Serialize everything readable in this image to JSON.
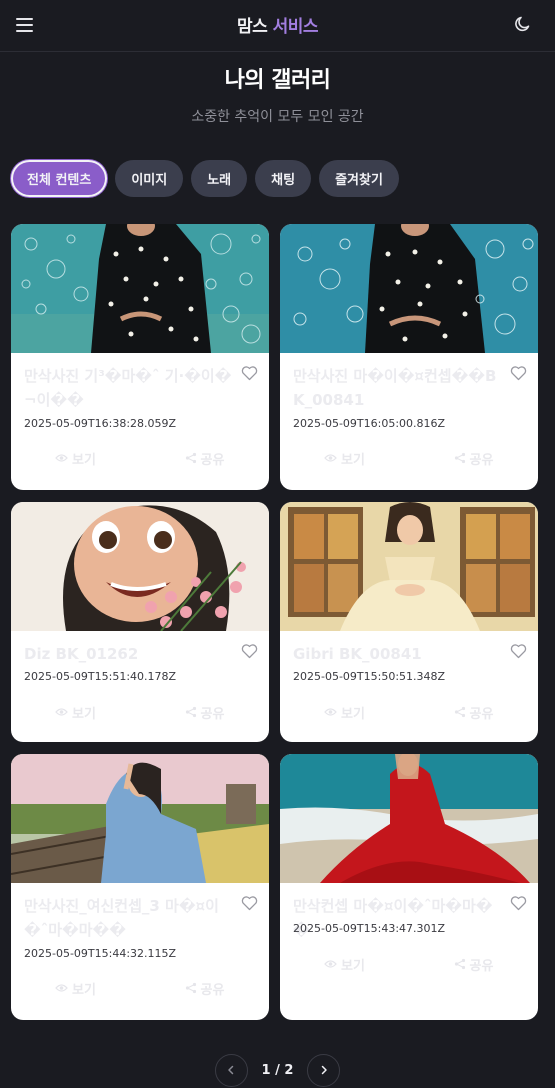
{
  "header": {
    "brand_part1": "맘스",
    "brand_part2": "서비스",
    "menu_icon": "hamburger-menu-icon",
    "theme_icon": "moon-icon"
  },
  "page": {
    "title": "나의 갤러리",
    "subtitle": "소중한 추억이 모두 모인 공간"
  },
  "tabs": [
    {
      "label": "전체 컨텐츠",
      "active": true
    },
    {
      "label": "이미지",
      "active": false
    },
    {
      "label": "노래",
      "active": false
    },
    {
      "label": "채팅",
      "active": false
    },
    {
      "label": "즐겨찾기",
      "active": false
    }
  ],
  "cards": [
    {
      "title": "만삭사진 기³�마�ˆ 기·�이�¬이��",
      "date": "2025-05-09T16:38:28.059Z",
      "view_label": "보기",
      "share_label": "공유"
    },
    {
      "title": "만삭사진 마�이�¤컨셉��BK_00841",
      "date": "2025-05-09T16:05:00.816Z",
      "view_label": "보기",
      "share_label": "공유"
    },
    {
      "title": "Diz BK_01262",
      "date": "2025-05-09T15:51:40.178Z",
      "view_label": "보기",
      "share_label": "공유"
    },
    {
      "title": "Gibri BK_00841",
      "date": "2025-05-09T15:50:51.348Z",
      "view_label": "보기",
      "share_label": "공유"
    },
    {
      "title": "만삭사진_여신컨셉_3 마�¤이�ˆ마�마��",
      "date": "2025-05-09T15:44:32.115Z",
      "view_label": "보기",
      "share_label": "공유"
    },
    {
      "title": "만삭컨셉 마�¤이�ˆ마�마��",
      "date": "2025-05-09T15:43:47.301Z",
      "view_label": "보기",
      "share_label": "공유"
    }
  ],
  "pagination": {
    "label": "1 / 2",
    "prev_icon": "chevron-left-icon",
    "next_icon": "chevron-right-icon"
  }
}
